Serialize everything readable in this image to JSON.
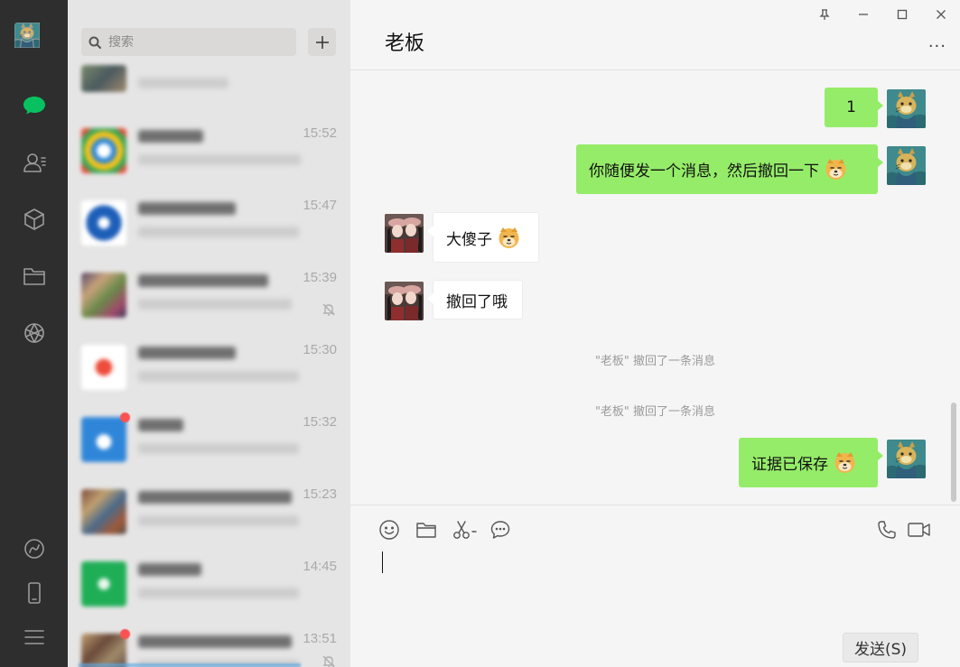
{
  "sidebar": {
    "icons": [
      "chat-icon",
      "contacts-icon",
      "collections-icon",
      "files-icon",
      "moments-icon",
      "channels-icon",
      "phone-icon",
      "menu-icon"
    ]
  },
  "search": {
    "placeholder": "搜索"
  },
  "conversations": [
    {
      "time": ""
    },
    {
      "time": "15:52"
    },
    {
      "time": "15:47"
    },
    {
      "time": "15:39"
    },
    {
      "time": "15:30"
    },
    {
      "time": "15:32"
    },
    {
      "time": "15:23"
    },
    {
      "time": "14:45"
    },
    {
      "time": "13:51"
    }
  ],
  "chat": {
    "title": "老板",
    "more": "···",
    "messages": {
      "m1": "1",
      "m2": "你随便发一个消息，然后撤回一下",
      "m3": "大傻子",
      "m4": "撤回了哦",
      "sys1": "\"老板\" 撤回了一条消息",
      "sys2": "\"老板\" 撤回了一条消息",
      "m5": "证据已保存"
    }
  },
  "composer": {
    "send_label": "发送(S)"
  },
  "colors": {
    "accent": "#07c160",
    "bubble_me": "#95ec69",
    "rail": "#2e2e2e"
  }
}
